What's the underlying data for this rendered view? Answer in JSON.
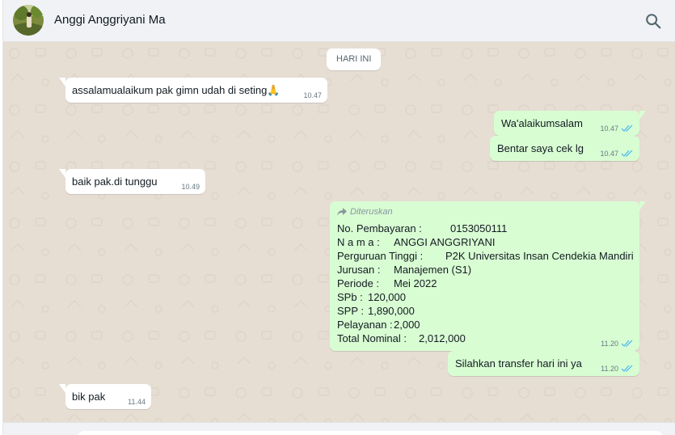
{
  "header": {
    "contact_name": "Anggi Anggriyani Ma",
    "search_icon": "search-icon"
  },
  "chat": {
    "date_divider": "HARI INI",
    "messages": [
      {
        "direction": "in",
        "text": "assalamualaikum pak gimn udah di seting🙏",
        "time": "10.47"
      },
      {
        "direction": "out",
        "text": "Wa'alaikumsalam",
        "time": "10.47",
        "status": "read"
      },
      {
        "direction": "out",
        "text": "Bentar saya cek lg",
        "time": "10.47",
        "status": "read"
      },
      {
        "direction": "in",
        "text": "baik pak.di tunggu",
        "time": "10.49"
      },
      {
        "direction": "out",
        "forwarded_label": "Diteruskan",
        "time": "11.20",
        "status": "read",
        "lines": [
          {
            "key": "No. Pembayaran        :",
            "value": " 0153050111"
          },
          {
            "key": "N a m a     :",
            "value": " ANGGI ANGGRIYANI"
          },
          {
            "key": "Perguruan Tinggi       :",
            "value": " P2K Universitas Insan Cendekia Mandiri"
          },
          {
            "key": "Jurusan     :",
            "value": " Manajemen (S1)"
          },
          {
            "key": "Periode      :",
            "value": " Mei 2022"
          },
          {
            "key": "SPb   :",
            "value": " 120,000"
          },
          {
            "key": "SPP   :",
            "value": " 1,890,000"
          },
          {
            "key": "Pelayanan :",
            "value": " 2,000"
          },
          {
            "key": "Total Nominal    :",
            "value": " 2,012,000"
          }
        ]
      },
      {
        "direction": "out",
        "text": "Silahkan transfer hari ini ya",
        "time": "11.20",
        "status": "read"
      },
      {
        "direction": "in",
        "text": "bik pak",
        "time": "11.44"
      }
    ]
  },
  "colors": {
    "incoming_bubble": "#ffffff",
    "outgoing_bubble": "#d9fdd3",
    "read_ticks": "#53bdeb",
    "chat_background": "#e6ddd3"
  }
}
